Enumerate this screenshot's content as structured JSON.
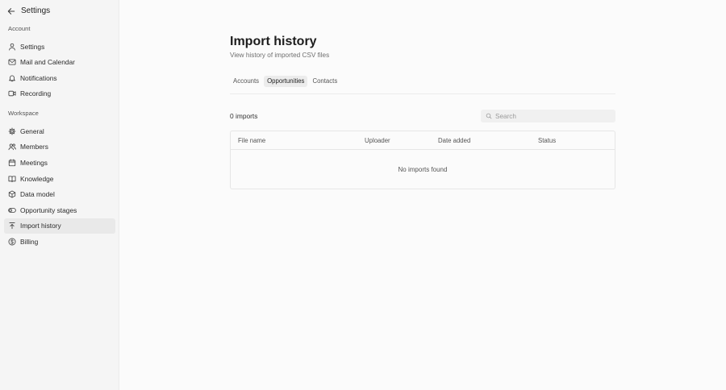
{
  "sidebar": {
    "title": "Settings",
    "account_label": "Account",
    "account_items": [
      {
        "label": "Settings",
        "icon": "user-icon"
      },
      {
        "label": "Mail and Calendar",
        "icon": "mail-icon"
      },
      {
        "label": "Notifications",
        "icon": "bell-icon"
      },
      {
        "label": "Recording",
        "icon": "video-icon"
      }
    ],
    "workspace_label": "Workspace",
    "workspace_items": [
      {
        "label": "General",
        "icon": "gear-icon"
      },
      {
        "label": "Members",
        "icon": "users-icon"
      },
      {
        "label": "Meetings",
        "icon": "calendar-icon"
      },
      {
        "label": "Knowledge",
        "icon": "book-icon"
      },
      {
        "label": "Data model",
        "icon": "cube-icon"
      },
      {
        "label": "Opportunity stages",
        "icon": "toggle-icon"
      },
      {
        "label": "Import history",
        "icon": "upload-icon",
        "active": true
      },
      {
        "label": "Billing",
        "icon": "dollar-circle-icon"
      }
    ]
  },
  "main": {
    "title": "Import history",
    "subtitle": "View history of imported CSV files",
    "tabs": [
      {
        "label": "Accounts"
      },
      {
        "label": "Opportunities",
        "active": true
      },
      {
        "label": "Contacts"
      }
    ],
    "count": "0 imports",
    "search": {
      "placeholder": "Search",
      "value": ""
    },
    "table": {
      "columns": [
        "File name",
        "Uploader",
        "Date added",
        "Status"
      ],
      "rows": [],
      "empty_text": "No imports found"
    }
  },
  "colors": {
    "sidebar_bg": "#f5f5f5",
    "main_bg": "#fbfbfb",
    "active_bg": "#e9e9e9",
    "border": "#e6e6e6"
  }
}
